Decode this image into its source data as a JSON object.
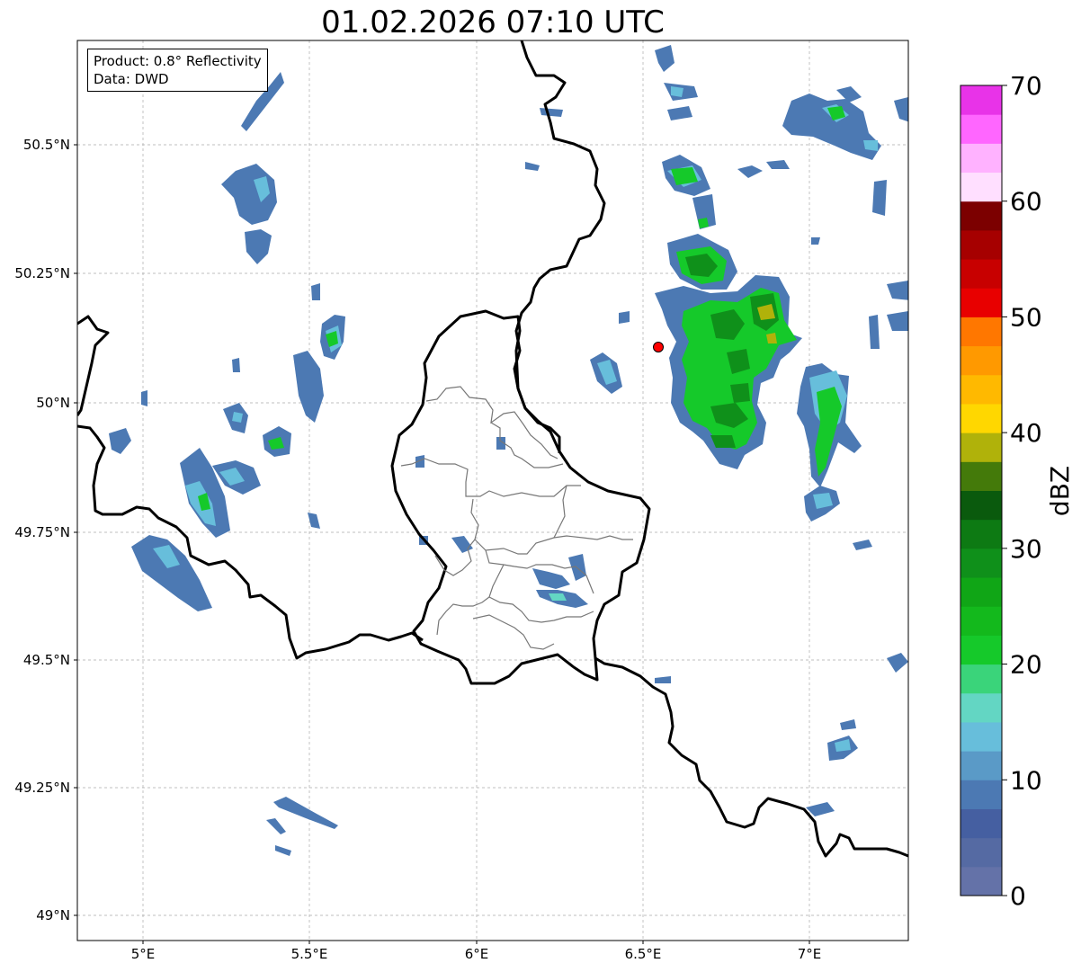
{
  "title": "01.02.2026 07:10 UTC",
  "info": {
    "product": "Product: 0.8° Reflectivity",
    "data": "Data: DWD"
  },
  "axes": {
    "lat_ticks": [
      "50.5°N",
      "50.25°N",
      "50°N",
      "49.75°N",
      "49.5°N",
      "49.25°N",
      "49°N"
    ],
    "lon_ticks": [
      "5°E",
      "5.5°E",
      "6°E",
      "6.5°E",
      "7°E"
    ]
  },
  "colorbar": {
    "label": "dBZ",
    "min": 0,
    "max": 70,
    "tick_labels": [
      "0",
      "10",
      "20",
      "30",
      "40",
      "50",
      "60",
      "70"
    ],
    "colors": [
      "#6472a8",
      "#556aa3",
      "#455fa1",
      "#4c79b3",
      "#5a9ac7",
      "#67bedb",
      "#63d6c3",
      "#3ad47a",
      "#15c92a",
      "#13b91c",
      "#10a616",
      "#0f901a",
      "#0d7a13",
      "#0a5a0d",
      "#447a0a",
      "#b0b20a",
      "#ffd700",
      "#ffb900",
      "#ff9900",
      "#ff7700",
      "#e80000",
      "#c80000",
      "#a60000",
      "#7c0000",
      "#ffdfff",
      "#ffb2ff",
      "#ff66ff",
      "#e833e8"
    ]
  },
  "legend_marker": {
    "color": "#ff0000"
  },
  "colors": {
    "border": "#000000",
    "district": "#777777",
    "grid": "#aaaaaa"
  }
}
